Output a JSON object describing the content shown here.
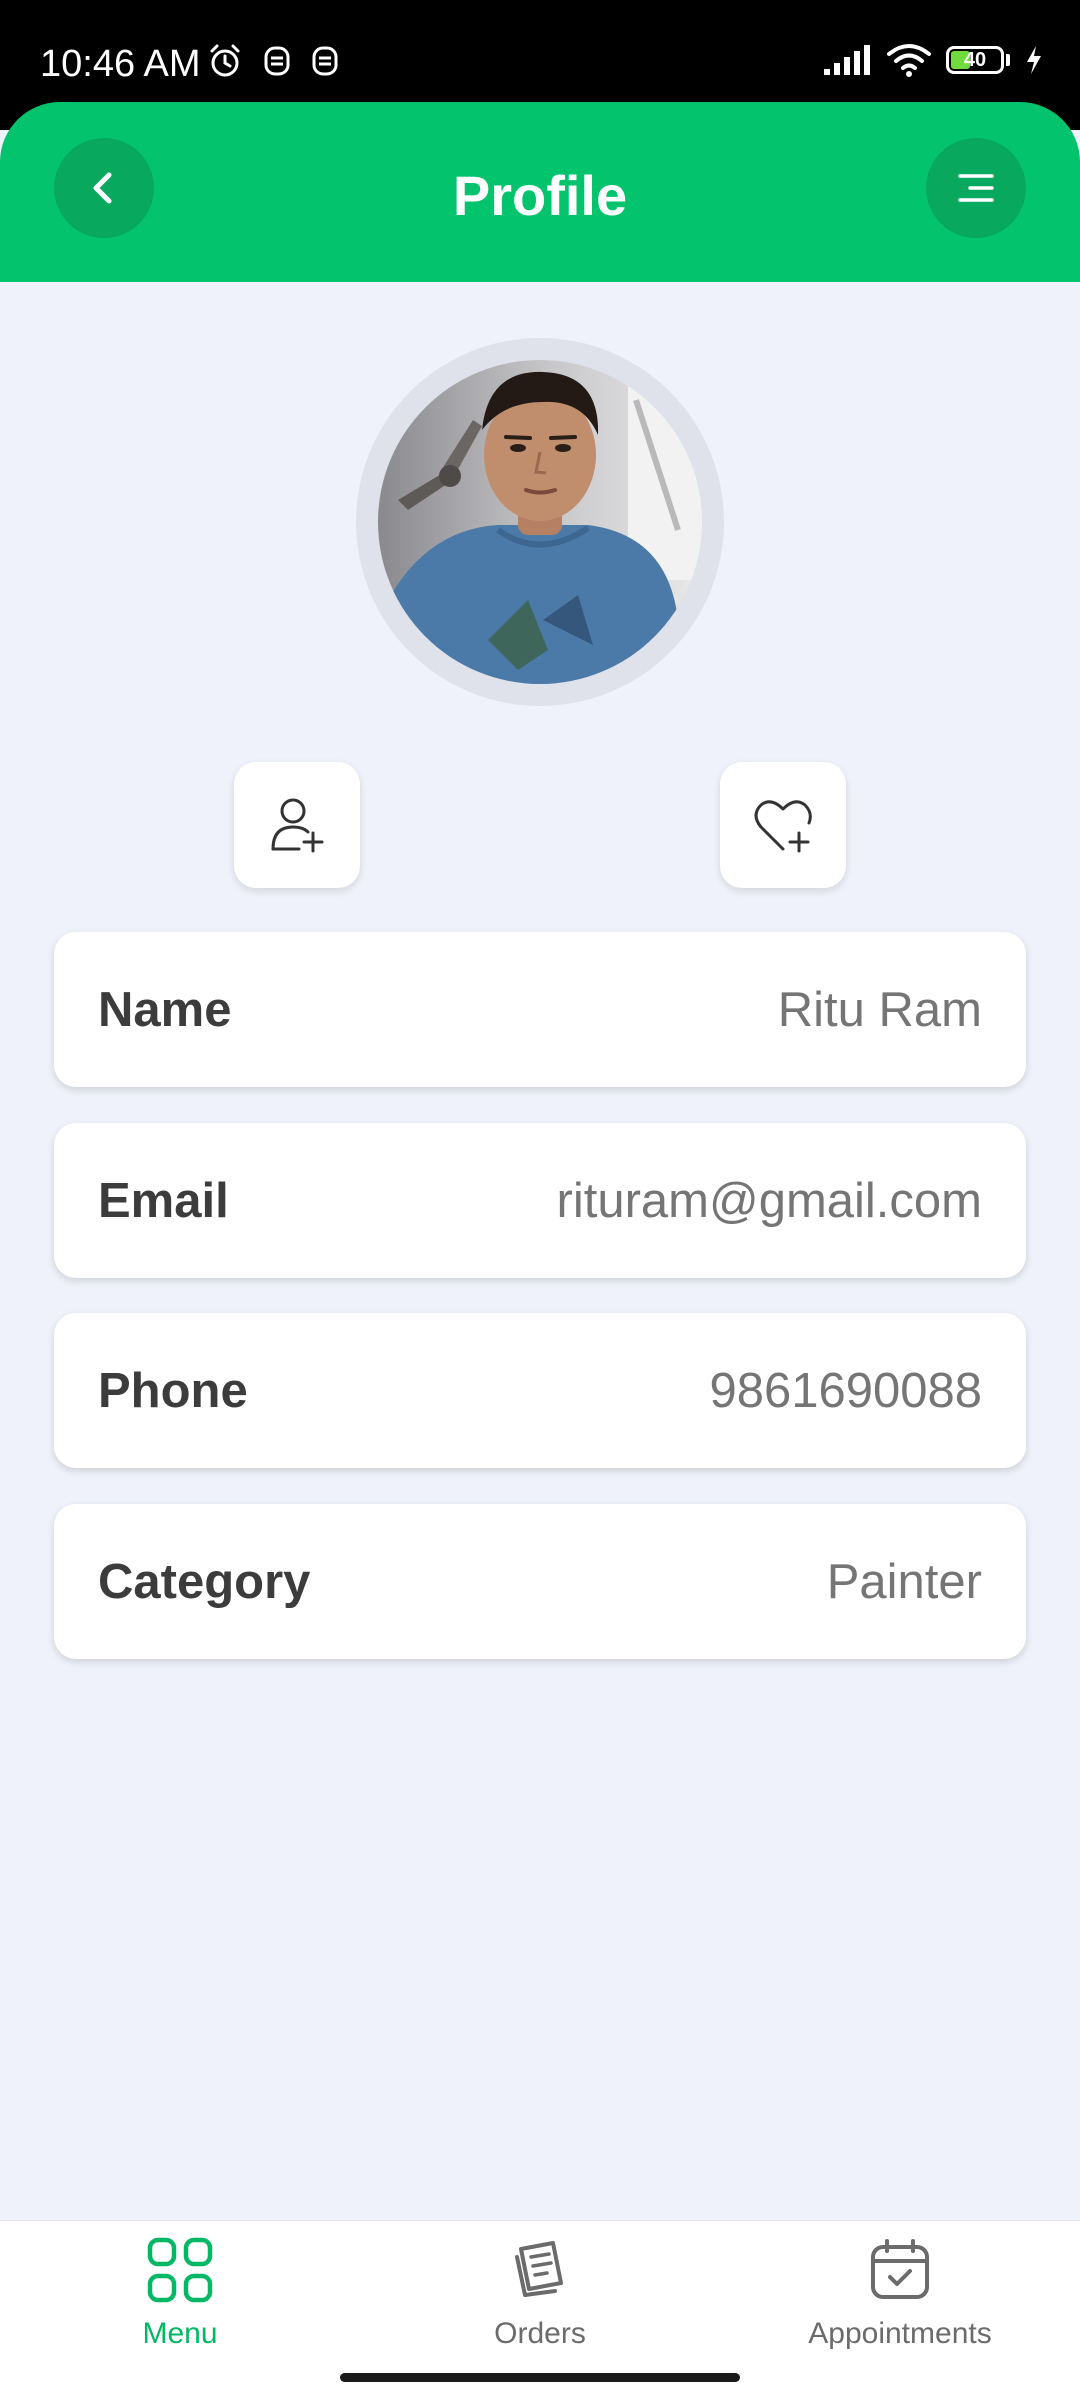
{
  "status_bar": {
    "time": "10:46 AM",
    "battery_level": "40"
  },
  "header": {
    "title": "Profile"
  },
  "profile_fields": [
    {
      "label": "Name",
      "value": "Ritu Ram"
    },
    {
      "label": "Email",
      "value": "rituram@gmail.com"
    },
    {
      "label": "Phone",
      "value": "9861690088"
    },
    {
      "label": "Category",
      "value": "Painter"
    }
  ],
  "bottom_nav": {
    "items": [
      {
        "label": "Menu",
        "icon": "grid-icon",
        "active": true
      },
      {
        "label": "Orders",
        "icon": "orders-icon",
        "active": false
      },
      {
        "label": "Appointments",
        "icon": "calendar-icon",
        "active": false
      }
    ]
  },
  "colors": {
    "accent": "#03c36d",
    "accent_dark": "#09a85f",
    "background": "#eff2fa",
    "nav_active": "#03b865"
  }
}
